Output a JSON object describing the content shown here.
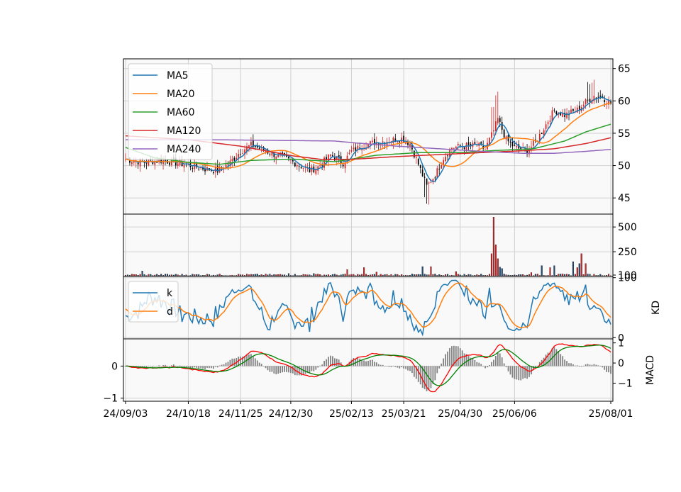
{
  "chart_data": [
    {
      "panel": "price",
      "type": "candlestick",
      "ylim": [
        42.5,
        66.5
      ],
      "yticks": [
        45,
        50,
        55,
        60,
        65
      ],
      "y_axis_side": "right",
      "grid": true,
      "legend_placement": "top-left",
      "x_ticks": [
        "24/09/03",
        "24/10/18",
        "24/11/25",
        "24/12/30",
        "25/02/13",
        "25/03/21",
        "25/04/30",
        "25/06/06",
        "25/08/01"
      ],
      "x_tick_index": [
        0,
        30,
        55,
        79,
        108,
        133,
        160,
        186,
        232
      ],
      "n_days": 233,
      "close_anchors": [
        [
          0,
          51.0
        ],
        [
          8,
          50.5
        ],
        [
          18,
          50.8
        ],
        [
          28,
          50.2
        ],
        [
          38,
          49.5
        ],
        [
          44,
          49.2
        ],
        [
          50,
          50.5
        ],
        [
          55,
          52.2
        ],
        [
          60,
          53.2
        ],
        [
          66,
          52.4
        ],
        [
          72,
          51.6
        ],
        [
          80,
          50.6
        ],
        [
          88,
          49.2
        ],
        [
          92,
          49.8
        ],
        [
          98,
          51.6
        ],
        [
          104,
          50.4
        ],
        [
          108,
          52.2
        ],
        [
          114,
          53.2
        ],
        [
          120,
          53.6
        ],
        [
          126,
          53.9
        ],
        [
          132,
          54.2
        ],
        [
          136,
          53.4
        ],
        [
          140,
          50.2
        ],
        [
          144,
          46.8
        ],
        [
          148,
          48.5
        ],
        [
          152,
          51.2
        ],
        [
          156,
          52.8
        ],
        [
          162,
          53.0
        ],
        [
          168,
          53.1
        ],
        [
          172,
          52.6
        ],
        [
          176,
          55.4
        ],
        [
          178,
          57.2
        ],
        [
          182,
          54.0
        ],
        [
          186,
          52.8
        ],
        [
          192,
          52.3
        ],
        [
          196,
          53.6
        ],
        [
          200,
          55.8
        ],
        [
          205,
          58.6
        ],
        [
          210,
          57.8
        ],
        [
          216,
          58.6
        ],
        [
          220,
          59.8
        ],
        [
          224,
          60.8
        ],
        [
          228,
          60.6
        ],
        [
          232,
          59.6
        ]
      ],
      "series": [
        {
          "name": "MA5",
          "color": "#1f77b4"
        },
        {
          "name": "MA20",
          "color": "#ff7f0e"
        },
        {
          "name": "MA60",
          "color": "#2ca02c",
          "anchors": [
            [
              0,
              52.8
            ],
            [
              14,
              51.2
            ],
            [
              30,
              50.5
            ],
            [
              45,
              50.2
            ],
            [
              60,
              50.8
            ],
            [
              80,
              51.0
            ],
            [
              100,
              50.6
            ],
            [
              120,
              51.6
            ],
            [
              140,
              52.0
            ],
            [
              160,
              52.0
            ],
            [
              175,
              52.3
            ],
            [
              195,
              52.6
            ],
            [
              210,
              53.8
            ],
            [
              220,
              55.2
            ],
            [
              232,
              56.4
            ]
          ]
        },
        {
          "name": "MA120",
          "color": "#d62728",
          "anchors": [
            [
              0,
              54.6
            ],
            [
              30,
              54.0
            ],
            [
              55,
              53.0
            ],
            [
              80,
              51.5
            ],
            [
              95,
              50.9
            ],
            [
              110,
              51.0
            ],
            [
              130,
              51.4
            ],
            [
              150,
              51.7
            ],
            [
              170,
              52.0
            ],
            [
              190,
              52.3
            ],
            [
              205,
              52.6
            ],
            [
              220,
              53.4
            ],
            [
              232,
              54.3
            ]
          ]
        },
        {
          "name": "MA240",
          "color": "#9467bd",
          "anchors": [
            [
              0,
              54.0
            ],
            [
              40,
              54.0
            ],
            [
              70,
              53.9
            ],
            [
              100,
              53.8
            ],
            [
              110,
              53.5
            ],
            [
              130,
              53.0
            ],
            [
              150,
              52.6
            ],
            [
              170,
              52.2
            ],
            [
              190,
              51.9
            ],
            [
              205,
              51.9
            ],
            [
              220,
              52.2
            ],
            [
              232,
              52.5
            ]
          ]
        }
      ]
    },
    {
      "panel": "volume",
      "type": "bar",
      "ylim": [
        0,
        630
      ],
      "yticks": [
        250,
        500
      ],
      "baseline_label": "100",
      "y_axis_side": "right",
      "up_color": "#d62728",
      "down_color": "#1f4e79",
      "spikes": [
        [
          8,
          55
        ],
        [
          20,
          25
        ],
        [
          40,
          20
        ],
        [
          78,
          30
        ],
        [
          90,
          30
        ],
        [
          106,
          70
        ],
        [
          114,
          90
        ],
        [
          120,
          45
        ],
        [
          142,
          100
        ],
        [
          146,
          100
        ],
        [
          158,
          50
        ],
        [
          175,
          230
        ],
        [
          176,
          600
        ],
        [
          177,
          320
        ],
        [
          178,
          180
        ],
        [
          179,
          95
        ],
        [
          180,
          80
        ],
        [
          194,
          40
        ],
        [
          199,
          110
        ],
        [
          203,
          90
        ],
        [
          205,
          110
        ],
        [
          214,
          150
        ],
        [
          216,
          90
        ],
        [
          217,
          130
        ],
        [
          218,
          230
        ],
        [
          220,
          130
        ]
      ]
    },
    {
      "panel": "kd",
      "type": "line",
      "ylim": [
        -2,
        102
      ],
      "yticks": [
        0,
        100
      ],
      "ylabel": "KD",
      "y_axis_side": "right",
      "legend_placement": "top-left",
      "series": [
        {
          "name": "k",
          "color": "#1f77b4"
        },
        {
          "name": "d",
          "color": "#ff7f0e"
        }
      ]
    },
    {
      "panel": "macd",
      "type": "bar+line",
      "ylim": [
        -1.1,
        0.85
      ],
      "yticks_left": [
        0,
        -1
      ],
      "yticks_right": [
        1,
        0,
        -1
      ],
      "right_ylim": [
        -1.9,
        1.2
      ],
      "ylabel": "MACD",
      "line_colors": [
        "#ff0000",
        "#008000"
      ],
      "hist_color": "#808080"
    }
  ]
}
